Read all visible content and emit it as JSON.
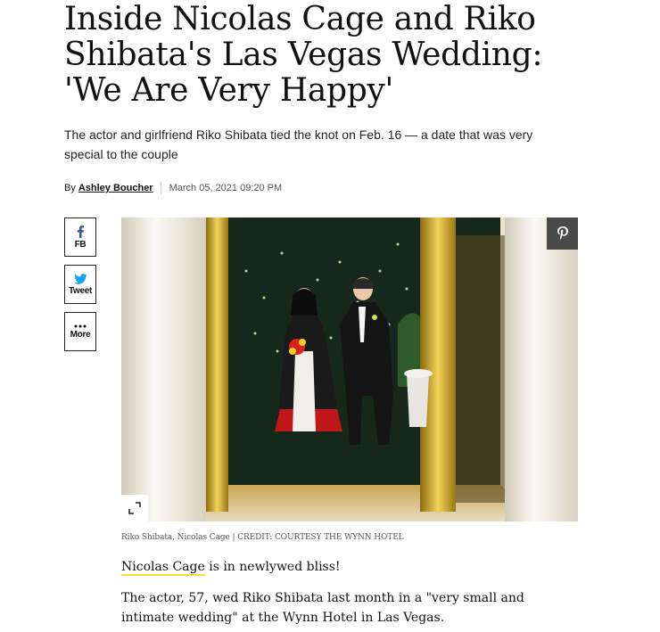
{
  "article": {
    "headline": "Inside Nicolas Cage and Riko Shibata's Las Vegas Wedding: 'We Are Very Happy'",
    "dek": "The actor and girlfriend Riko Shibata tied the knot on Feb. 16 — a date that was very special to the couple",
    "byline": {
      "prefix": "By",
      "author": "Ashley Boucher",
      "date": "March 05, 2021 09:20 PM"
    },
    "share": {
      "facebook_label": "FB",
      "twitter_label": "Tweet",
      "more_label": "More"
    },
    "image": {
      "caption": "Riko Shibata, Nicolas Cage | CREDIT: COURTESY THE WYNN HOTEL",
      "pin_icon": "pinterest-icon",
      "expand_icon": "expand-icon"
    },
    "body": {
      "p1_link": "Nicolas Cage",
      "p1_rest": " is in newlywed bliss!",
      "p2": "The actor, 57, wed Riko Shibata last month in a \"very small and intimate wedding\" at the Wynn Hotel in Las Vegas."
    }
  },
  "colors": {
    "facebook": "#3b5998",
    "twitter": "#1da1f2",
    "link_underline": "#f5e13a",
    "pin_button": "#4a4a4a"
  }
}
